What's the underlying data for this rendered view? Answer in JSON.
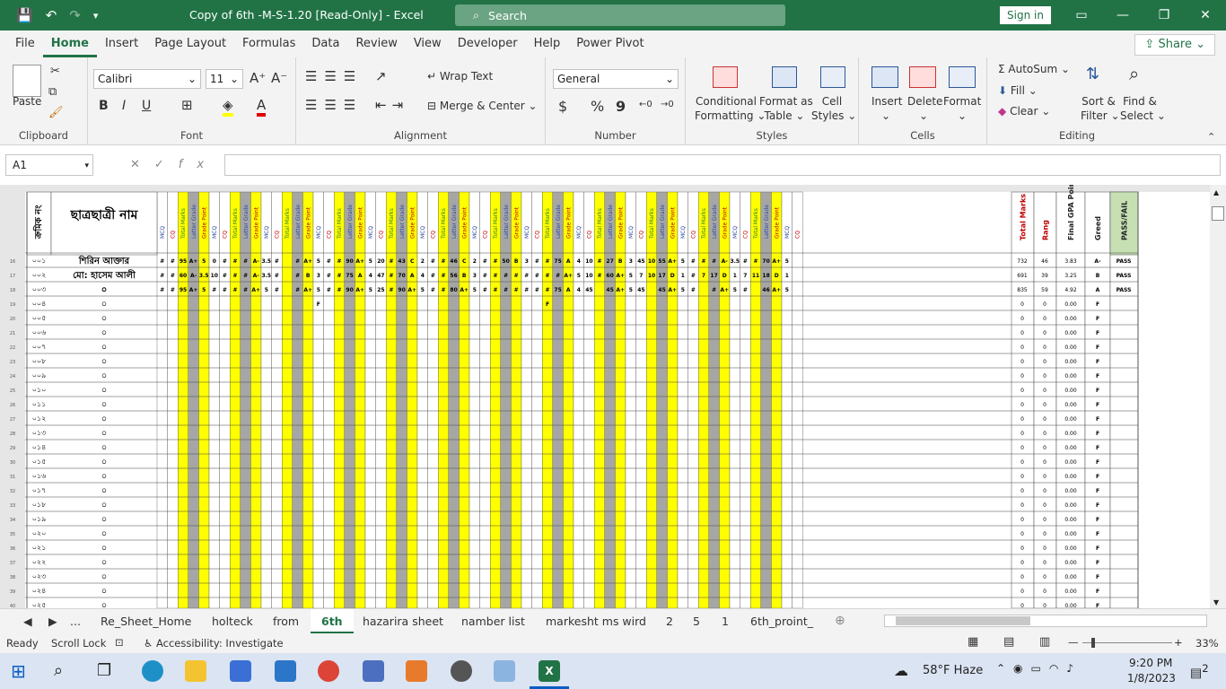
{
  "window": {
    "title": "Copy of 6th -M-S-1.20  [Read-Only]  -  Excel",
    "search_placeholder": "Search",
    "sign_in": "Sign in"
  },
  "ribbon_tabs": [
    "File",
    "Home",
    "Insert",
    "Page Layout",
    "Formulas",
    "Data",
    "Review",
    "View",
    "Developer",
    "Help",
    "Power Pivot"
  ],
  "share_label": "Share",
  "ribbon": {
    "clipboard": {
      "paste": "Paste",
      "label": "Clipboard"
    },
    "font": {
      "name": "Calibri",
      "size": "11",
      "bold": "B",
      "italic": "I",
      "underline": "U",
      "label": "Font"
    },
    "alignment": {
      "wrap": "Wrap Text",
      "merge": "Merge & Center",
      "label": "Alignment"
    },
    "number": {
      "format": "General",
      "currency": "$",
      "percent": "%",
      "comma": "9",
      "label": "Number"
    },
    "styles": {
      "conditional": "Conditional",
      "conditional2": "Formatting",
      "format_table": "Format as",
      "format_table2": "Table",
      "cell_styles": "Cell",
      "cell_styles2": "Styles",
      "label": "Styles"
    },
    "cells": {
      "insert": "Insert",
      "delete": "Delete",
      "format": "Format",
      "label": "Cells"
    },
    "editing": {
      "autosum": "AutoSum",
      "fill": "Fill",
      "clear": "Clear",
      "sort": "Sort &",
      "sort2": "Filter",
      "find": "Find &",
      "find2": "Select",
      "label": "Editing"
    }
  },
  "formula_bar": {
    "name_box": "A1",
    "fx": "fx",
    "value": ""
  },
  "sheet": {
    "header_name": "ছাত্রছাত্রী নাম",
    "header_roll": "ক্রমিক নং",
    "subject_headers": [
      "MCQ",
      "CQ",
      "Total Marks",
      "Letter Grade",
      "Grade Point"
    ],
    "summary_headers": [
      "Total Marks",
      "Rang",
      "Final GPA Point",
      "Greed",
      "PASS/FAIL"
    ],
    "students": [
      {
        "roll": "০০১",
        "name": "শিরিন আক্তার",
        "total": "732",
        "rank": "46",
        "gpa": "3.83",
        "grade": "A-",
        "result": "PASS"
      },
      {
        "roll": "০০২",
        "name": "মো: হাসেম আলী",
        "total": "691",
        "rank": "39",
        "gpa": "3.25",
        "grade": "B",
        "result": "PASS"
      },
      {
        "roll": "০০৩",
        "name": "০",
        "total": "835",
        "rank": "59",
        "gpa": "4.92",
        "grade": "A",
        "result": "PASS"
      }
    ],
    "empty_rolls": [
      "০০৪",
      "০০৫",
      "০০৬",
      "০০৭",
      "০০৮",
      "০০৯",
      "০১০",
      "০১১",
      "০১২",
      "০১৩",
      "০১৪",
      "০১৫",
      "০১৬",
      "০১৭",
      "০১৮",
      "০১৯",
      "০২০",
      "০২১",
      "০২২",
      "০২৩",
      "০২৪",
      "০২৫",
      "০২৬"
    ],
    "empty_name": "০",
    "empty_total": "0",
    "empty_rank": "0",
    "empty_gpa": "0.00",
    "empty_grade": "F",
    "row1_cells": [
      "#",
      "#",
      "95",
      "A+",
      "5",
      "0",
      "#",
      "#",
      "#",
      "A-",
      "3.5",
      "#",
      "",
      "#",
      "A+",
      "5",
      "#",
      "#",
      "90",
      "A+",
      "5",
      "20",
      "#",
      "43",
      "C",
      "2",
      "#",
      "#",
      "46",
      "C",
      "2",
      "#",
      "#",
      "50",
      "B",
      "3",
      "#",
      "#",
      "75",
      "A",
      "4",
      "10",
      "#",
      "27",
      "B",
      "3",
      "45",
      "10",
      "55",
      "A+",
      "5",
      "#",
      "#",
      "#",
      "A-",
      "3.5",
      "#",
      "#",
      "70",
      "A+",
      "5"
    ],
    "row2_cells": [
      "#",
      "#",
      "60",
      "A-",
      "3.5",
      "10",
      "#",
      "#",
      "#",
      "A-",
      "3.5",
      "#",
      "",
      "#",
      "B",
      "3",
      "#",
      "#",
      "75",
      "A",
      "4",
      "47",
      "#",
      "70",
      "A",
      "4",
      "#",
      "#",
      "56",
      "B",
      "3",
      "#",
      "#",
      "#",
      "#",
      "#",
      "#",
      "#",
      "#",
      "A+",
      "5",
      "10",
      "#",
      "60",
      "A+",
      "5",
      "7",
      "10",
      "17",
      "D",
      "1",
      "#",
      "7",
      "17",
      "D",
      "1",
      "7",
      "11",
      "18",
      "D",
      "1"
    ],
    "row3_cells": [
      "#",
      "#",
      "95",
      "A+",
      "5",
      "#",
      "#",
      "#",
      "#",
      "A+",
      "5",
      "#",
      "",
      "#",
      "A+",
      "5",
      "#",
      "#",
      "90",
      "A+",
      "5",
      "25",
      "#",
      "90",
      "A+",
      "5",
      "#",
      "#",
      "80",
      "A+",
      "5",
      "#",
      "#",
      "#",
      "#",
      "#",
      "#",
      "#",
      "75",
      "A",
      "4",
      "45",
      "",
      "45",
      "A+",
      "5",
      "45",
      "",
      "45",
      "A+",
      "5",
      "#",
      "",
      "#",
      "A+",
      "5",
      "#",
      "",
      "46",
      "A+",
      "5"
    ],
    "row4_f": "F"
  },
  "sheet_tabs": [
    "Re_Sheet_Home",
    "holteck",
    "from",
    "6th",
    "hazarira sheet",
    "namber list",
    "markesht ms wird",
    "2",
    "5",
    "1",
    "6th_proint_"
  ],
  "active_sheet": "6th",
  "status": {
    "ready": "Ready",
    "scroll_lock": "Scroll Lock",
    "accessibility": "Accessibility: Investigate",
    "zoom": "33%"
  },
  "taskbar": {
    "weather": "58°F  Haze",
    "time": "9:20 PM",
    "date": "1/8/2023",
    "notif": "2"
  },
  "colors": {
    "excel_green": "#217346",
    "yellow": "#ffff00",
    "gray": "#a6a6a6"
  }
}
